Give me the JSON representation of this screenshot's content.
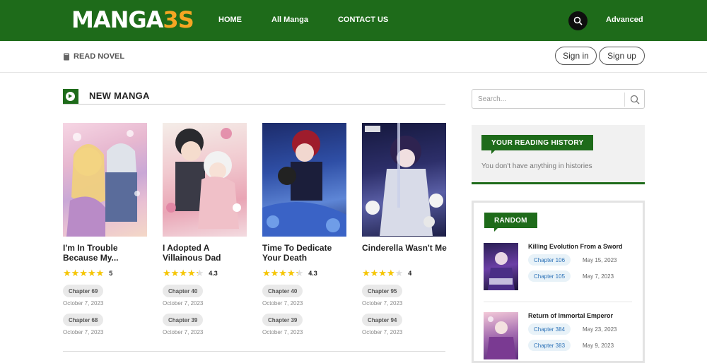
{
  "header": {
    "logo_main": "MANGA",
    "logo_accent": "3S",
    "nav": [
      "HOME",
      "All Manga",
      "CONTACT US"
    ],
    "advanced": "Advanced"
  },
  "subbar": {
    "read_novel": "READ NOVEL",
    "signin": "Sign in",
    "signup": "Sign up"
  },
  "new_manga": {
    "title": "NEW MANGA",
    "items": [
      {
        "title": "I'm In Trouble Because My...",
        "rating": 5,
        "rating_label": "5",
        "chapters": [
          {
            "label": "Chapter 69",
            "date": "October 7, 2023"
          },
          {
            "label": "Chapter 68",
            "date": "October 7, 2023"
          }
        ]
      },
      {
        "title": "I Adopted A Villainous Dad",
        "rating": 4.3,
        "rating_label": "4.3",
        "chapters": [
          {
            "label": "Chapter 40",
            "date": "October 7, 2023"
          },
          {
            "label": "Chapter 39",
            "date": "October 7, 2023"
          }
        ]
      },
      {
        "title": "Time To Dedicate Your Death",
        "rating": 4.3,
        "rating_label": "4.3",
        "chapters": [
          {
            "label": "Chapter 40",
            "date": "October 7, 2023"
          },
          {
            "label": "Chapter 39",
            "date": "October 7, 2023"
          }
        ]
      },
      {
        "title": "Cinderella Wasn't Me",
        "rating": 4,
        "rating_label": "4",
        "chapters": [
          {
            "label": "Chapter 95",
            "date": "October 7, 2023"
          },
          {
            "label": "Chapter 94",
            "date": "October 7, 2023"
          }
        ]
      }
    ]
  },
  "sidebar": {
    "search_placeholder": "Search...",
    "history_title": "YOUR READING HISTORY",
    "history_empty": "You don't have anything in histories",
    "random_title": "RANDOM",
    "random": [
      {
        "title": "Killing Evolution From a Sword",
        "chapters": [
          {
            "label": "Chapter 106",
            "date": "May 15, 2023"
          },
          {
            "label": "Chapter 105",
            "date": "May 7, 2023"
          }
        ]
      },
      {
        "title": "Return of Immortal Emperor",
        "chapters": [
          {
            "label": "Chapter 384",
            "date": "May 23, 2023"
          },
          {
            "label": "Chapter 383",
            "date": "May 9, 2023"
          }
        ]
      }
    ]
  },
  "colors": {
    "brand_green": "#1e6b1a",
    "logo_orange": "#f5a623",
    "star": "#f7c600",
    "chapter_link": "#2e73b8"
  }
}
